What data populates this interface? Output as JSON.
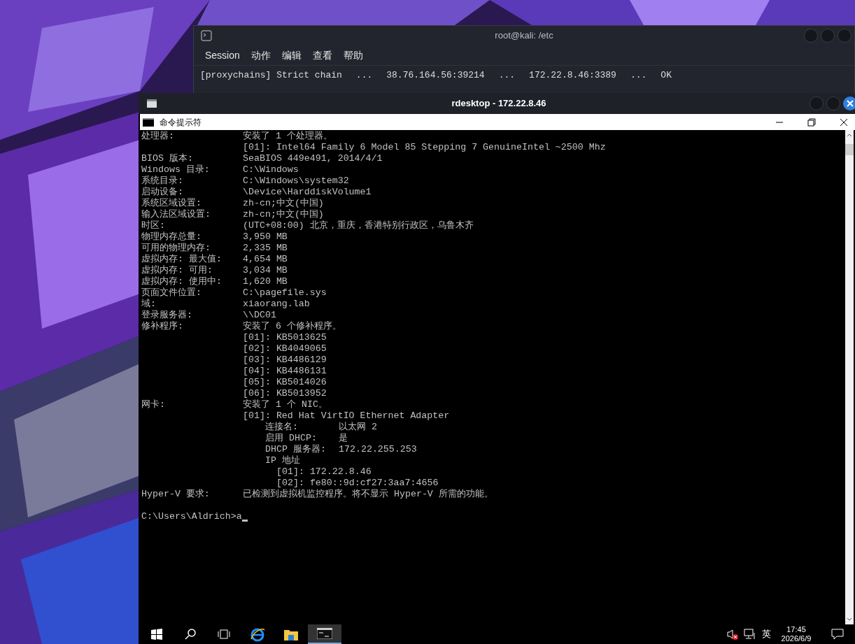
{
  "kali_terminal": {
    "title": "root@kali: /etc",
    "menu": [
      {
        "label": "Session"
      },
      {
        "label": "动作"
      },
      {
        "label": "编辑"
      },
      {
        "label": "查看"
      },
      {
        "label": "帮助"
      }
    ],
    "output": [
      {
        "segments": [
          "[proxychains] Strict chain",
          "...",
          "38.76.164.56:39214",
          "...",
          "172.22.8.46:3389",
          "...",
          "OK"
        ]
      }
    ]
  },
  "rdesktop": {
    "title": "rdesktop - 172.22.8.46",
    "cmd_window": {
      "title": "命令提示符",
      "lines": [
        {
          "kind": "field",
          "label": "处理器:",
          "value": "安装了 1 个处理器。"
        },
        {
          "kind": "item",
          "value": "[01]: Intel64 Family 6 Model 85 Stepping 7 GenuineIntel ~2500 Mhz"
        },
        {
          "kind": "field",
          "label": "BIOS 版本:",
          "value": "SeaBIOS 449e491, 2014/4/1"
        },
        {
          "kind": "field",
          "label": "Windows 目录:",
          "value": "C:\\Windows"
        },
        {
          "kind": "field",
          "label": "系统目录:",
          "value": "C:\\Windows\\system32"
        },
        {
          "kind": "field",
          "label": "启动设备:",
          "value": "\\Device\\HarddiskVolume1"
        },
        {
          "kind": "field",
          "label": "系统区域设置:",
          "value": "zh-cn;中文(中国)"
        },
        {
          "kind": "field",
          "label": "输入法区域设置:",
          "value": "zh-cn;中文(中国)"
        },
        {
          "kind": "field",
          "label": "时区:",
          "value": "(UTC+08:00) 北京，重庆，香港特别行政区，乌鲁木齐"
        },
        {
          "kind": "field",
          "label": "物理内存总量:",
          "value": "3,950 MB"
        },
        {
          "kind": "field",
          "label": "可用的物理内存:",
          "value": "2,335 MB"
        },
        {
          "kind": "field",
          "label": "虚拟内存: 最大值:",
          "value": "4,654 MB"
        },
        {
          "kind": "field",
          "label": "虚拟内存: 可用:",
          "value": "3,034 MB"
        },
        {
          "kind": "field",
          "label": "虚拟内存: 使用中:",
          "value": "1,620 MB"
        },
        {
          "kind": "field",
          "label": "页面文件位置:",
          "value": "C:\\pagefile.sys"
        },
        {
          "kind": "field",
          "label": "域:",
          "value": "xiaorang.lab"
        },
        {
          "kind": "field",
          "label": "登录服务器:",
          "value": "\\\\DC01"
        },
        {
          "kind": "field",
          "label": "修补程序:",
          "value": "安装了 6 个修补程序。"
        },
        {
          "kind": "item",
          "value": "[01]: KB5013625"
        },
        {
          "kind": "item",
          "value": "[02]: KB4049065"
        },
        {
          "kind": "item",
          "value": "[03]: KB4486129"
        },
        {
          "kind": "item",
          "value": "[04]: KB4486131"
        },
        {
          "kind": "item",
          "value": "[05]: KB5014026"
        },
        {
          "kind": "item",
          "value": "[06]: KB5013952"
        },
        {
          "kind": "field",
          "label": "网卡:",
          "value": "安装了 1 个 NIC。"
        },
        {
          "kind": "item",
          "value": "[01]: Red Hat VirtIO Ethernet Adapter"
        },
        {
          "kind": "nic-field",
          "label": "连接名:",
          "value": "以太网 2"
        },
        {
          "kind": "nic-field",
          "label": "启用 DHCP:",
          "value": "是"
        },
        {
          "kind": "nic-field",
          "label": "DHCP 服务器:",
          "value": "172.22.255.253"
        },
        {
          "kind": "nic-field",
          "label": "IP 地址"
        },
        {
          "kind": "nic-item",
          "value": "[01]: 172.22.8.46"
        },
        {
          "kind": "nic-item",
          "value": "[02]: fe80::9d:cf27:3aa7:4656"
        },
        {
          "kind": "field",
          "label": "Hyper-V 要求:",
          "value": "已检测到虚拟机监控程序。将不显示 Hyper-V 所需的功能。"
        },
        {
          "kind": "blank"
        },
        {
          "kind": "prompt",
          "prompt": "C:\\Users\\Aldrich>",
          "input": "a"
        }
      ]
    },
    "taskbar": {
      "apps": [
        {
          "kind": "browser",
          "active": false
        },
        {
          "kind": "folder",
          "active": false
        },
        {
          "kind": "console",
          "active": true
        }
      ],
      "input_language": "英",
      "time": "17:45",
      "date": "2026/6/9"
    }
  }
}
